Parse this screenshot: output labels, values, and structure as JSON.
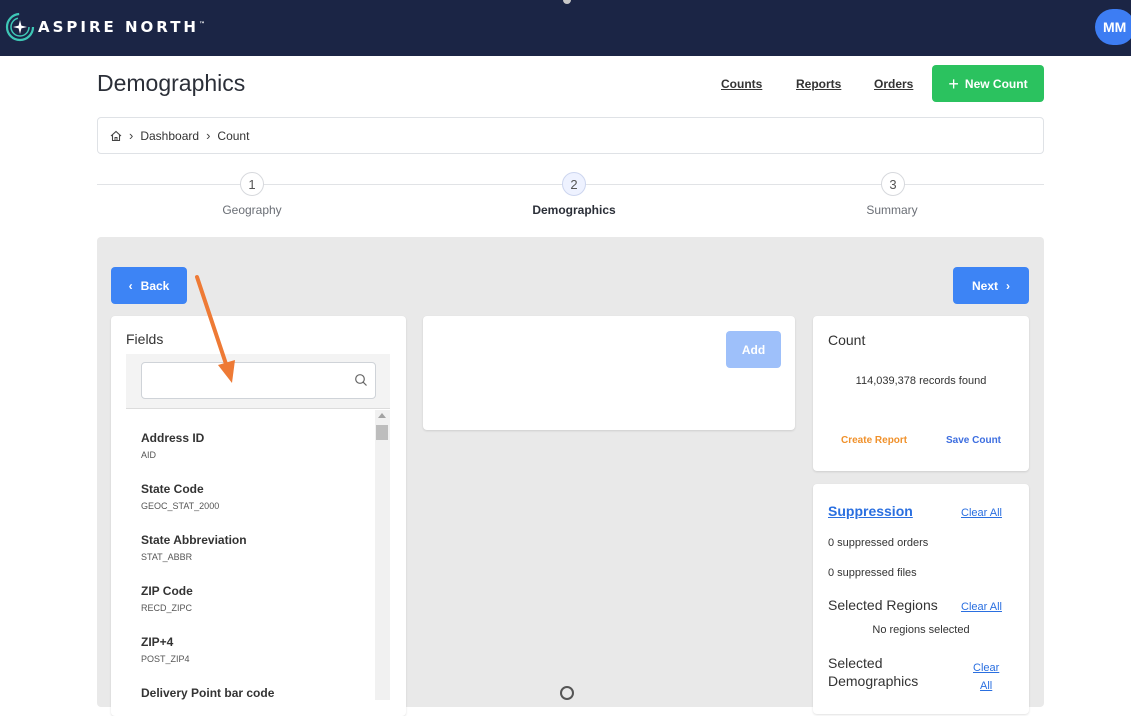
{
  "brand": {
    "name": "ASPIRE NORTH",
    "tm": "™"
  },
  "user": {
    "initials": "MM"
  },
  "header": {
    "title": "Demographics",
    "links": [
      "Counts",
      "Reports",
      "Orders"
    ],
    "new_count_label": "New Count"
  },
  "breadcrumb": {
    "items": [
      "Dashboard",
      "Count"
    ]
  },
  "steps": [
    {
      "number": "1",
      "label": "Geography"
    },
    {
      "number": "2",
      "label": "Demographics"
    },
    {
      "number": "3",
      "label": "Summary"
    }
  ],
  "nav": {
    "back_label": "Back",
    "next_label": "Next"
  },
  "fields_panel": {
    "title": "Fields",
    "search": {
      "value": "",
      "placeholder": ""
    },
    "items": [
      {
        "name": "Address ID",
        "code": "AID"
      },
      {
        "name": "State Code",
        "code": "GEOC_STAT_2000"
      },
      {
        "name": "State Abbreviation",
        "code": "STAT_ABBR"
      },
      {
        "name": "ZIP Code",
        "code": "RECD_ZIPC"
      },
      {
        "name": "ZIP+4",
        "code": "POST_ZIP4"
      },
      {
        "name": "Delivery Point bar code",
        "code": ""
      }
    ]
  },
  "criteria_panel": {
    "add_label": "Add"
  },
  "count_panel": {
    "title": "Count",
    "records_text": "114,039,378 records found",
    "create_report_label": "Create Report",
    "save_count_label": "Save Count"
  },
  "suppression_panel": {
    "title": "Suppression",
    "clear_all": "Clear All",
    "suppressed_orders": "0 suppressed orders",
    "suppressed_files": "0 suppressed files",
    "regions_title": "Selected Regions",
    "regions_clear": "Clear All",
    "no_regions": "No regions selected",
    "demographics_title_line1": "Selected",
    "demographics_title_line2": "Demographics",
    "demographics_clear_line1": "Clear",
    "demographics_clear_line2": "All"
  },
  "colors": {
    "topbar": "#1b2545",
    "accent_blue": "#3d84f5",
    "new_count_green": "#2bc25f",
    "create_report_orange": "#f0912b",
    "annotation_arrow": "#ee7a35"
  }
}
